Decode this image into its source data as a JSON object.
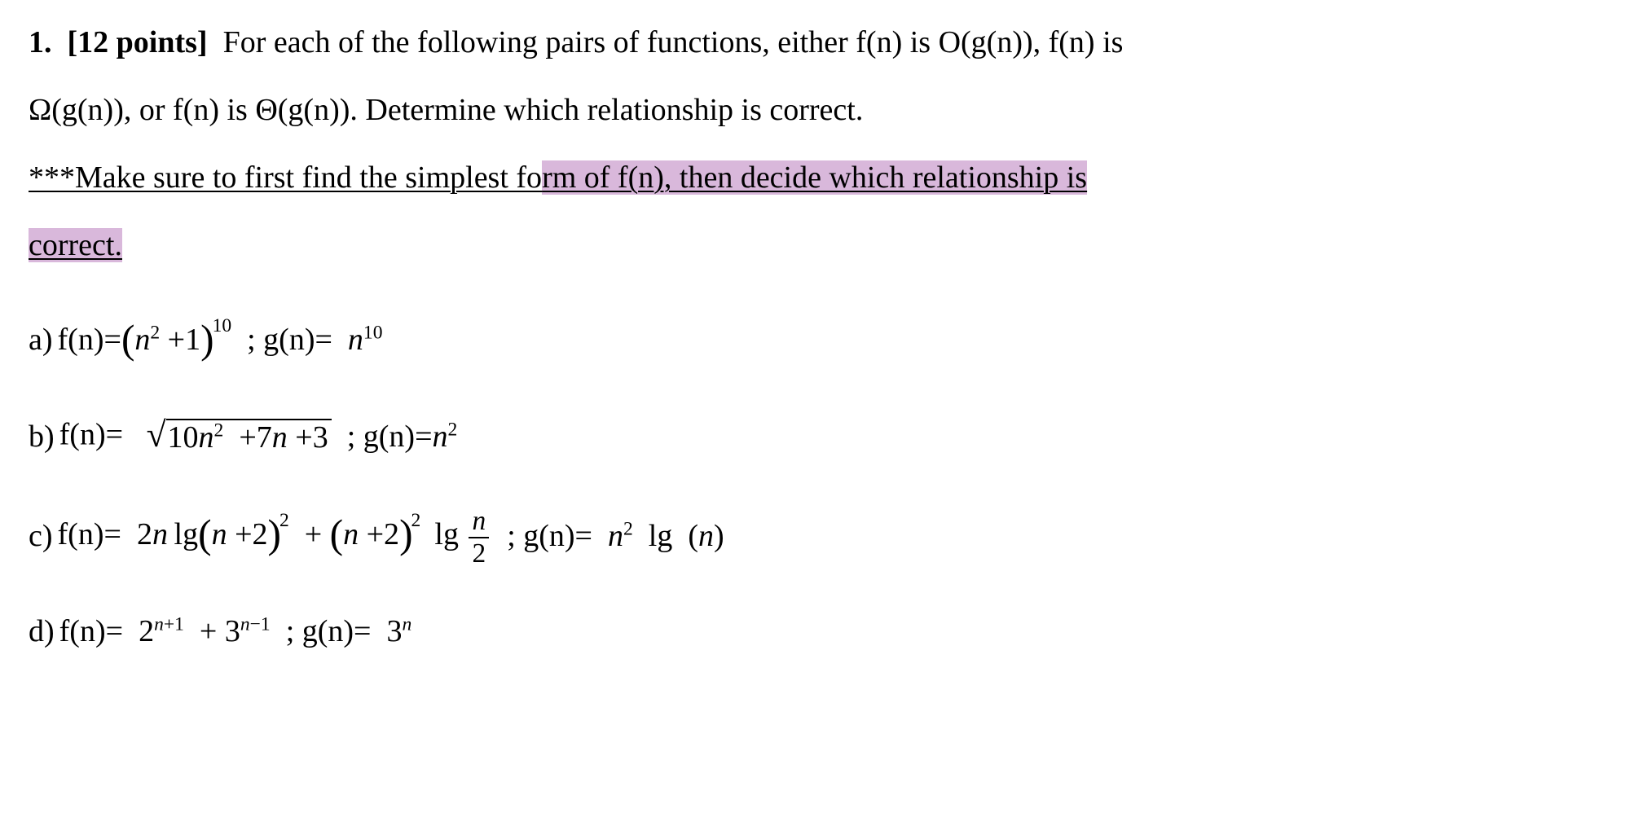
{
  "problem": {
    "number": "1.",
    "points": "[12 points]",
    "statement_line1": "For each of the following pairs of functions, either f(n) is O(g(n)), f(n) is",
    "statement_line2": "Ω(g(n)), or f(n) is Θ(g(n)). Determine which relationship is correct.",
    "note_prefix": "***Make sure to first find the simplest fo",
    "note_highlighted1": "rm of f(n), then decide which relationship is",
    "note_highlighted2": "correct."
  },
  "items": {
    "a": {
      "label": "a)",
      "fn_prefix": "f(n)=",
      "fn_base": "n",
      "fn_base_exp": "2",
      "fn_plus": "+1",
      "fn_outer_exp": "10",
      "sep": ";",
      "gn_prefix": "g(n)=",
      "gn_base": "n",
      "gn_exp": "10"
    },
    "b": {
      "label": "b)",
      "fn_prefix": "f(n)=",
      "sqrt_coef": "10",
      "sqrt_n": "n",
      "sqrt_n_exp": "2",
      "sqrt_mid": "+7",
      "sqrt_n2": "n",
      "sqrt_tail": "+3",
      "sep": ";",
      "gn_prefix": "g(n)=",
      "gn_base": "n",
      "gn_exp": "2"
    },
    "c": {
      "label": "c)",
      "fn_prefix": "f(n)=",
      "t1_coef": "2",
      "t1_n": "n",
      "t1_lg": "lg",
      "t1_inner_n": "n",
      "t1_inner_plus": "+2",
      "t1_exp": "2",
      "plus": "+",
      "t2_inner_n": "n",
      "t2_inner_plus": "+2",
      "t2_exp": "2",
      "t2_lg": "lg",
      "frac_num": "n",
      "frac_den": "2",
      "sep": ";",
      "gn_prefix": "g(n)=",
      "gn_base": "n",
      "gn_exp": "2",
      "gn_lg": "lg",
      "gn_paren_n": "n"
    },
    "d": {
      "label": "d)",
      "fn_prefix": "f(n)=",
      "t1_base": "2",
      "t1_exp_n": "n",
      "t1_exp_suffix": "+1",
      "plus": "+",
      "t2_base": "3",
      "t2_exp_n": "n",
      "t2_exp_suffix": "−1",
      "sep": ";",
      "gn_prefix": "g(n)=",
      "gn_base": "3",
      "gn_exp": "n"
    }
  }
}
